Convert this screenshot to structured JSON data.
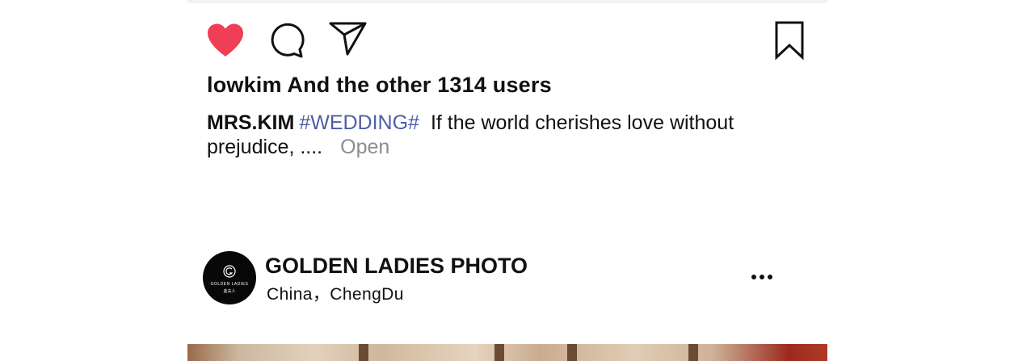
{
  "colors": {
    "like_red": "#ef3e55",
    "hashtag_blue": "#4b5ea8",
    "muted_gray": "#8c8c8c",
    "text_black": "#111111"
  },
  "post_actions": {
    "icons": [
      "heart-icon",
      "comment-icon",
      "share-icon",
      "bookmark-icon"
    ]
  },
  "likes": {
    "text": "lowkim And the other 1314 users"
  },
  "caption": {
    "username": "MRS.KIM",
    "hashtag": "#WEDDING#",
    "text": "If the world cherishes love without prejudice, ....",
    "open_label": "Open"
  },
  "next_post": {
    "avatar": {
      "logo_name": "GOLDEN LADIES",
      "logo_sub": "金夫人"
    },
    "account_name": "GOLDEN LADIES PHOTO",
    "location": "China，ChengDu"
  }
}
